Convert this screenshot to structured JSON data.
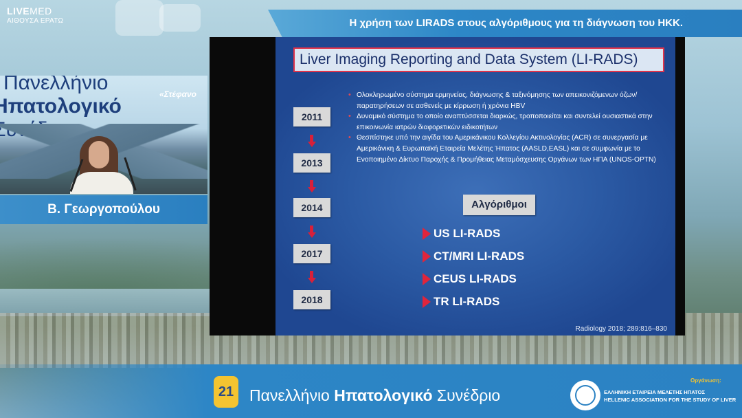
{
  "header": {
    "brand_bold": "LIVE",
    "brand_rest": "MED",
    "room": "ΑΙΘΟΥΣΑ ΕΡΑΤΩ",
    "talk_title": "Η χρήση των LIRADS στους αλγόριθμους για τη διάγνωση του ΗΚΚ."
  },
  "camera": {
    "banner_line1": "ι Πανελλήνιο",
    "banner_line2": "Ηπατολογικό",
    "banner_line3": "Συνέδριο",
    "quote": "«Στέφανο",
    "speaker_name": "Β. Γεωργοπούλου"
  },
  "slide": {
    "title": "Liver Imaging Reporting and Data System (LI-RADS)",
    "bullets": [
      "Ολοκληρωμένο σύστημα ερμηνείας, διάγνωσης & ταξινόμησης των απεικονιζόμενων όζων/ παρατηρήσεων σε ασθενείς με κίρρωση ή χρόνια HBV",
      "Δυναμικό σύστημα το οποίο αναπτύσσεται διαρκώς, τροποποιείται και συντελεί ουσιαστικά στην επικοινωνία ιατρών διαφορετικών ειδικοτήτων",
      "Θεσπίστηκε υπό την αιγίδα του Αμερικάνικου Κολλεγίου Ακτινολογίας (ACR) σε συνεργασία με Αμερικάνικη & Ευρωπαϊκή  Εταιρεία Μελέτης Ήπατος (AASLD,EASL) και σε συμφωνία με το Ενοποιημένο Δίκτυο Παροχής & Προμήθειας Μεταμόσχευσης Οργάνων των ΗΠΑ (UNOS-OPTN)"
    ],
    "years": [
      "2011",
      "2013",
      "2014",
      "2017",
      "2018"
    ],
    "algorithms_heading": "Αλγόριθμοι",
    "algorithms": [
      "US  LI-RADS",
      "CT/MRI  LI-RADS",
      "CEUS  LI-RADS",
      "TR  LI-RADS"
    ],
    "citation": "Radiology 2018; 289:816–830",
    "accent_color": "#e0253c"
  },
  "footer": {
    "badge": "21",
    "conf_word1": "Πανελλήνιο ",
    "conf_word2": "Ηπατολογικό",
    "conf_word3": " Συνέδριο",
    "organizer_label": "Οργάνωση:",
    "org_line1": "ΕΛΛΗΝΙΚΗ ΕΤΑΙΡΕΙΑ ΜΕΛΕΤΗΣ ΗΠΑΤΟΣ",
    "org_line2": "HELLENIC ASSOCIATION FOR THE STUDY OF LIVER"
  }
}
